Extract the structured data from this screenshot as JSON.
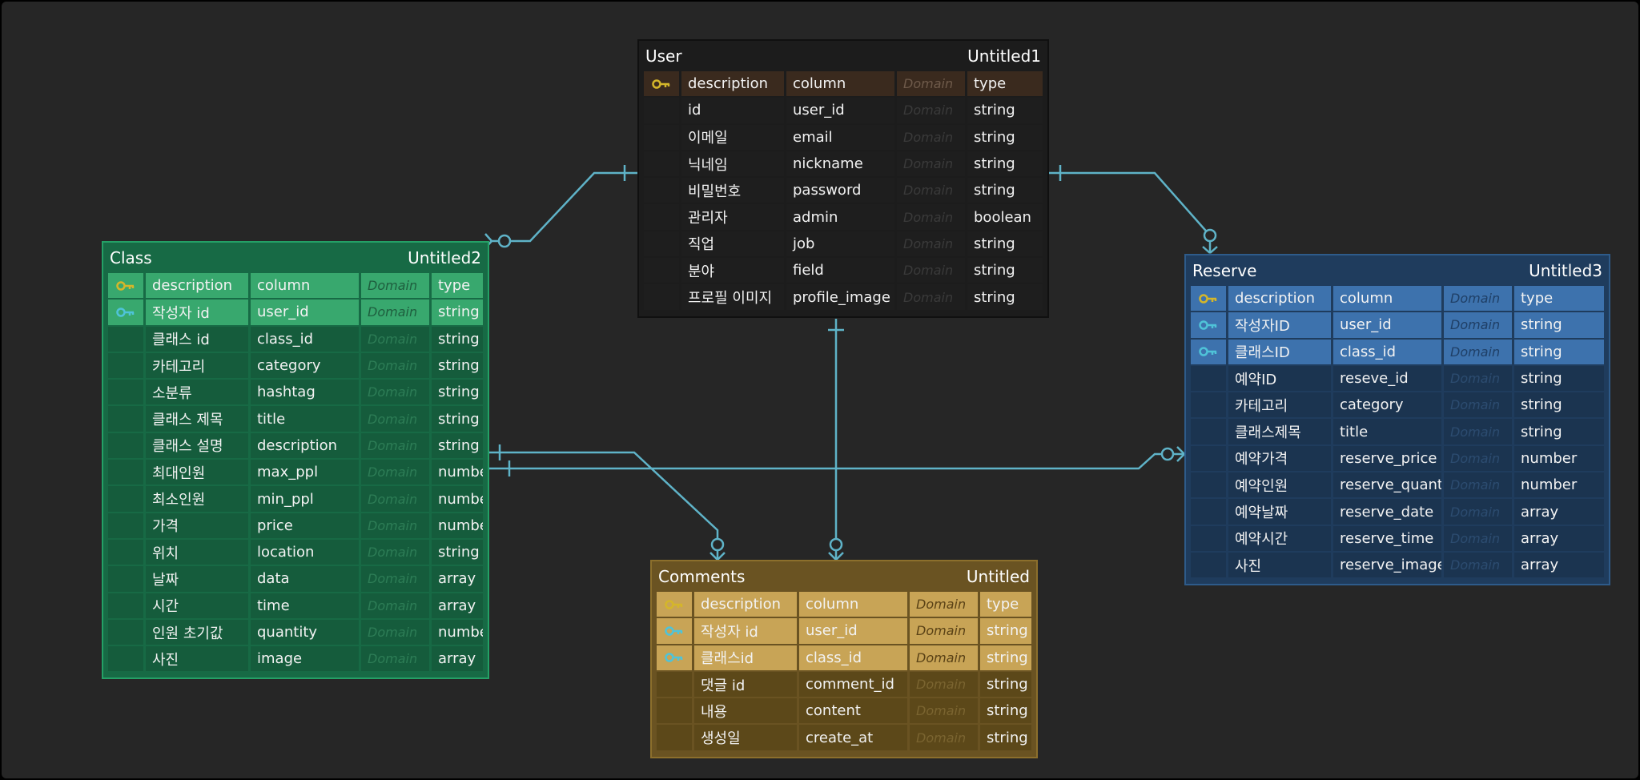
{
  "colors": {
    "relation_line": "#5fb3c8",
    "primary_key": "#d4b62a",
    "foreign_key": "#4fc3d8"
  },
  "entities": {
    "user": {
      "name": "User",
      "table": "Untitled1",
      "columns": [
        {
          "key": "primary",
          "description": "description",
          "column": "column",
          "domain": "Domain",
          "type": "type"
        },
        {
          "key": "",
          "description": "id",
          "column": "user_id",
          "domain": "Domain",
          "type": "string"
        },
        {
          "key": "",
          "description": "이메일",
          "column": "email",
          "domain": "Domain",
          "type": "string"
        },
        {
          "key": "",
          "description": "닉네임",
          "column": "nickname",
          "domain": "Domain",
          "type": "string"
        },
        {
          "key": "",
          "description": "비밀번호",
          "column": "password",
          "domain": "Domain",
          "type": "string"
        },
        {
          "key": "",
          "description": "관리자",
          "column": "admin",
          "domain": "Domain",
          "type": "boolean"
        },
        {
          "key": "",
          "description": "직업",
          "column": "job",
          "domain": "Domain",
          "type": "string"
        },
        {
          "key": "",
          "description": "분야",
          "column": "field",
          "domain": "Domain",
          "type": "string"
        },
        {
          "key": "",
          "description": "프로필 이미지",
          "column": "profile_image",
          "domain": "Domain",
          "type": "string"
        }
      ]
    },
    "class": {
      "name": "Class",
      "table": "Untitled2",
      "columns": [
        {
          "key": "primary",
          "description": "description",
          "column": "column",
          "domain": "Domain",
          "type": "type"
        },
        {
          "key": "foreign",
          "description": "작성자 id",
          "column": "user_id",
          "domain": "Domain",
          "type": "string"
        },
        {
          "key": "",
          "description": "클래스 id",
          "column": "class_id",
          "domain": "Domain",
          "type": "string"
        },
        {
          "key": "",
          "description": "카테고리",
          "column": "category",
          "domain": "Domain",
          "type": "string"
        },
        {
          "key": "",
          "description": "소분류",
          "column": "hashtag",
          "domain": "Domain",
          "type": "string"
        },
        {
          "key": "",
          "description": "클래스 제목",
          "column": "title",
          "domain": "Domain",
          "type": "string"
        },
        {
          "key": "",
          "description": "클래스 설명",
          "column": "description",
          "domain": "Domain",
          "type": "string"
        },
        {
          "key": "",
          "description": "최대인원",
          "column": "max_ppl",
          "domain": "Domain",
          "type": "number"
        },
        {
          "key": "",
          "description": "최소인원",
          "column": "min_ppl",
          "domain": "Domain",
          "type": "number"
        },
        {
          "key": "",
          "description": "가격",
          "column": "price",
          "domain": "Domain",
          "type": "number"
        },
        {
          "key": "",
          "description": "위치",
          "column": "location",
          "domain": "Domain",
          "type": "string"
        },
        {
          "key": "",
          "description": "날짜",
          "column": "data",
          "domain": "Domain",
          "type": "array"
        },
        {
          "key": "",
          "description": "시간",
          "column": "time",
          "domain": "Domain",
          "type": "array"
        },
        {
          "key": "",
          "description": "인원 초기값",
          "column": "quantity",
          "domain": "Domain",
          "type": "number"
        },
        {
          "key": "",
          "description": "사진",
          "column": "image",
          "domain": "Domain",
          "type": "array"
        }
      ]
    },
    "reserve": {
      "name": "Reserve",
      "table": "Untitled3",
      "columns": [
        {
          "key": "primary",
          "description": "description",
          "column": "column",
          "domain": "Domain",
          "type": "type"
        },
        {
          "key": "foreign",
          "description": "작성자ID",
          "column": "user_id",
          "domain": "Domain",
          "type": "string"
        },
        {
          "key": "foreign",
          "description": "클래스ID",
          "column": "class_id",
          "domain": "Domain",
          "type": "string"
        },
        {
          "key": "",
          "description": "예약ID",
          "column": "reseve_id",
          "domain": "Domain",
          "type": "string"
        },
        {
          "key": "",
          "description": "카테고리",
          "column": "category",
          "domain": "Domain",
          "type": "string"
        },
        {
          "key": "",
          "description": "클래스제목",
          "column": "title",
          "domain": "Domain",
          "type": "string"
        },
        {
          "key": "",
          "description": "예약가격",
          "column": "reserve_price",
          "domain": "Domain",
          "type": "number"
        },
        {
          "key": "",
          "description": "예약인원",
          "column": "reserve_quantity",
          "domain": "Domain",
          "type": "number"
        },
        {
          "key": "",
          "description": "예약날짜",
          "column": "reserve_date",
          "domain": "Domain",
          "type": "array"
        },
        {
          "key": "",
          "description": "예약시간",
          "column": "reserve_time",
          "domain": "Domain",
          "type": "array"
        },
        {
          "key": "",
          "description": "사진",
          "column": "reserve_image",
          "domain": "Domain",
          "type": "array"
        }
      ]
    },
    "comments": {
      "name": "Comments",
      "table": "Untitled",
      "columns": [
        {
          "key": "primary",
          "description": "description",
          "column": "column",
          "domain": "Domain",
          "type": "type"
        },
        {
          "key": "foreign",
          "description": "작성자 id",
          "column": "user_id",
          "domain": "Domain",
          "type": "string"
        },
        {
          "key": "foreign",
          "description": "클래스id",
          "column": "class_id",
          "domain": "Domain",
          "type": "string"
        },
        {
          "key": "",
          "description": "댓글 id",
          "column": "comment_id",
          "domain": "Domain",
          "type": "string"
        },
        {
          "key": "",
          "description": "내용",
          "column": "content",
          "domain": "Domain",
          "type": "string"
        },
        {
          "key": "",
          "description": "생성일",
          "column": "create_at",
          "domain": "Domain",
          "type": "string"
        }
      ]
    }
  },
  "relations": [
    {
      "from": "user",
      "to": "class",
      "from_end": "one",
      "to_end": "zero-or-many"
    },
    {
      "from": "user",
      "to": "reserve",
      "from_end": "one",
      "to_end": "zero-or-many"
    },
    {
      "from": "user",
      "to": "comments",
      "from_end": "one",
      "to_end": "zero-or-many"
    },
    {
      "from": "class",
      "to": "comments",
      "from_end": "one",
      "to_end": "zero-or-many"
    },
    {
      "from": "class",
      "to": "reserve",
      "from_end": "one",
      "to_end": "zero-or-many"
    }
  ]
}
